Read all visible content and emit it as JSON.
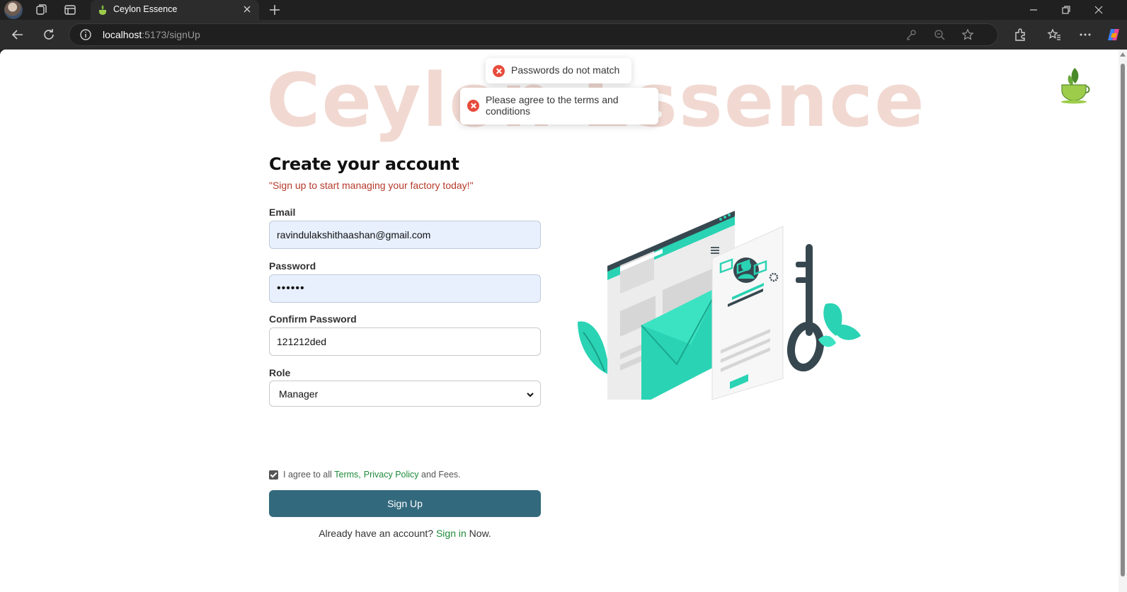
{
  "browser": {
    "tab_title": "Ceylon Essence",
    "url_host": "localhost",
    "url_path": ":5173/signUp"
  },
  "page": {
    "brand_watermark": "Ceylon Essence",
    "toasts": [
      {
        "message": "Passwords do not match"
      },
      {
        "message": "Please agree to the terms and conditions"
      }
    ],
    "heading": "Create your account",
    "tagline": "\"Sign up to start managing your factory today!\"",
    "email": {
      "label": "Email",
      "value": "ravindulakshithaashan@gmail.com"
    },
    "password": {
      "label": "Password",
      "value": "••••••"
    },
    "confirm_password": {
      "label": "Confirm Password",
      "value": "121212ded"
    },
    "role": {
      "label": "Role",
      "value": "Manager"
    },
    "agree": {
      "prefix": "I agree to all ",
      "terms": "Terms,",
      "privacy": "Privacy Policy",
      "suffix": " and Fees."
    },
    "signup_button": "Sign Up",
    "signin": {
      "prefix": "Already have an account? ",
      "link": "Sign in",
      "suffix": " Now."
    }
  },
  "colors": {
    "accent": "#33697d",
    "link_green": "#1e8a3a",
    "tagline_red": "#b63a2a",
    "illustration_teal": "#2ad3b4"
  }
}
